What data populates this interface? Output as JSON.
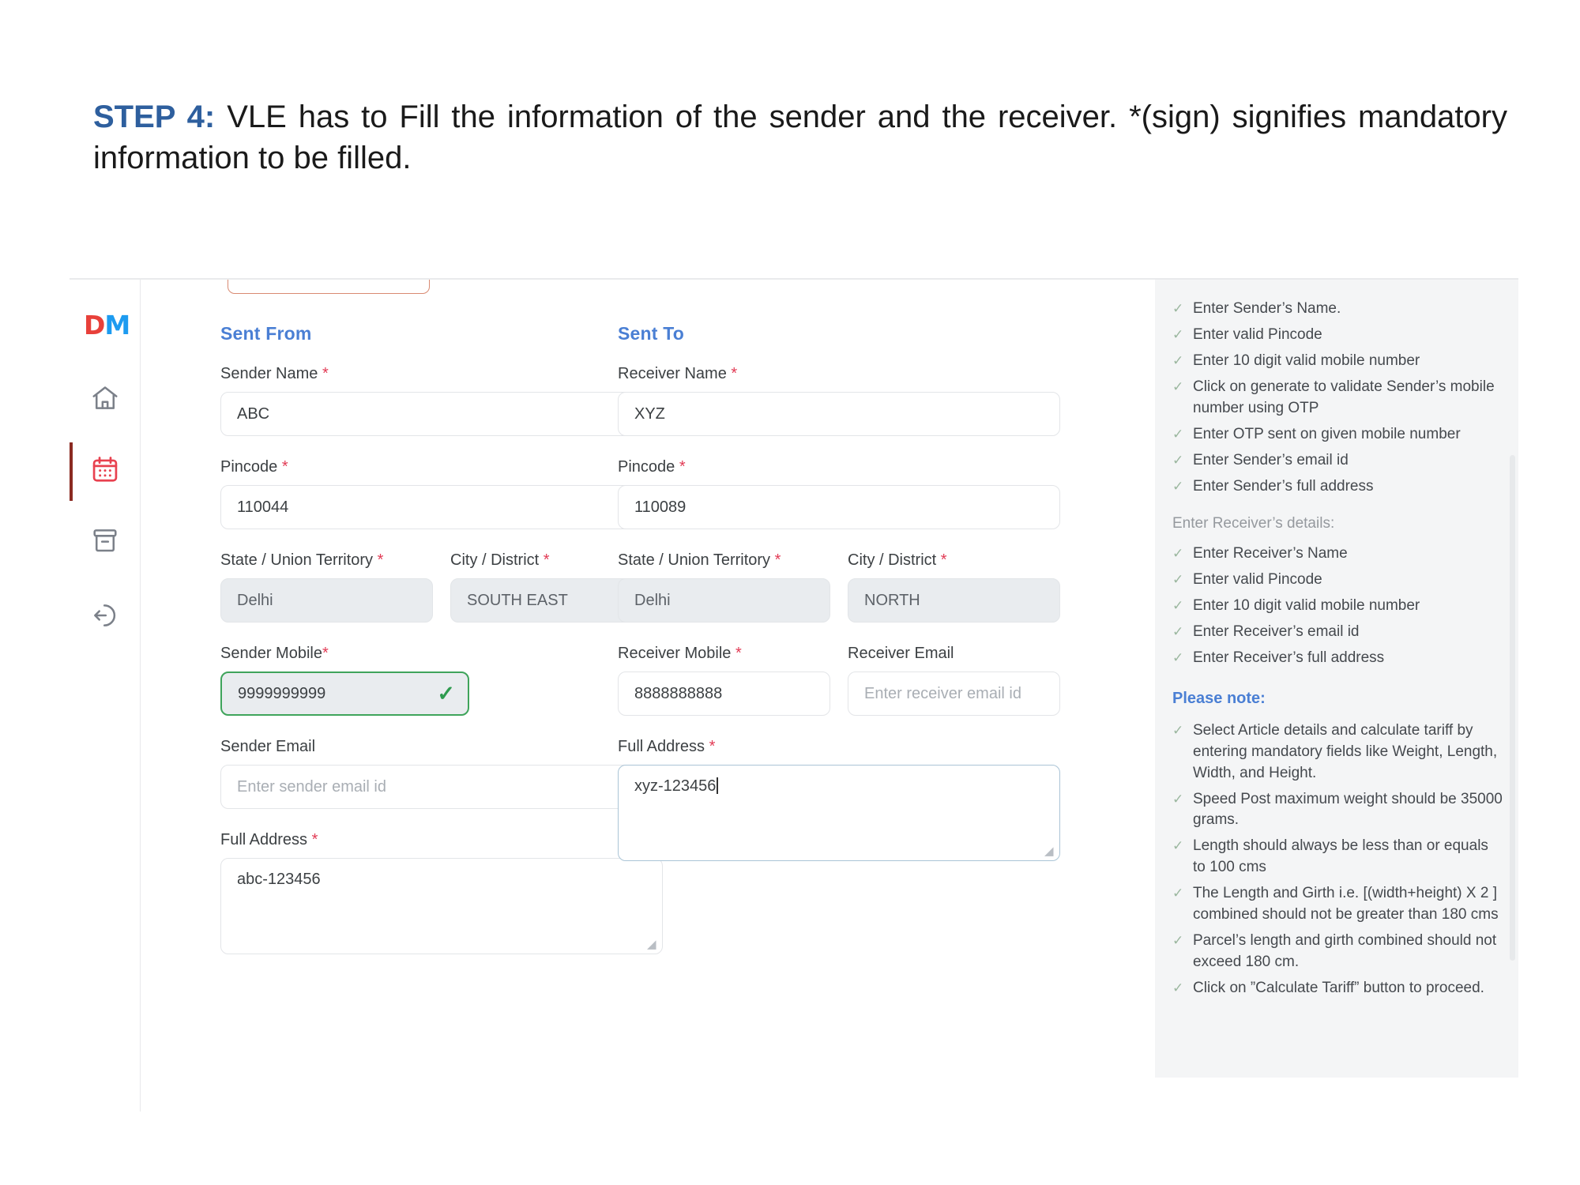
{
  "slide": {
    "step_label": "STEP 4:",
    "body": "VLE has to Fill the information of the sender and the receiver. *(sign) signifies mandatory information to be filled."
  },
  "colors": {
    "accent_blue": "#4a7fd4",
    "required_red": "#e23b55",
    "valid_green": "#3fa45b",
    "logo_red": "#e8403a",
    "logo_blue": "#1d9bf0",
    "active_rail": "#8b2a22"
  },
  "sidebar": {
    "logo_first": "D",
    "logo_second": "M",
    "items": [
      {
        "name": "home-icon",
        "label": "Home",
        "active": false
      },
      {
        "name": "calendar-icon",
        "label": "Booking",
        "active": true
      },
      {
        "name": "archive-icon",
        "label": "Archive",
        "active": false
      },
      {
        "name": "logout-icon",
        "label": "Logout",
        "active": false
      }
    ]
  },
  "sender": {
    "section_title": "Sent From",
    "name_label": "Sender Name",
    "name_value": "ABC",
    "pincode_label": "Pincode",
    "pincode_value": "110044",
    "state_label": "State / Union Territory",
    "state_value": "Delhi",
    "city_label": "City / District",
    "city_value": "SOUTH EAST",
    "mobile_label": "Sender Mobile",
    "mobile_value": "9999999999",
    "mobile_valid_icon": "check-icon",
    "email_label": "Sender Email",
    "email_value": "",
    "email_placeholder": "Enter sender email id",
    "address_label": "Full Address",
    "address_value": "abc-123456"
  },
  "receiver": {
    "section_title": "Sent To",
    "name_label": "Receiver Name",
    "name_value": "XYZ",
    "pincode_label": "Pincode",
    "pincode_value": "110089",
    "state_label": "State / Union Territory",
    "state_value": "Delhi",
    "city_label": "City / District",
    "city_value": "NORTH",
    "mobile_label": "Receiver Mobile",
    "mobile_value": "8888888888",
    "email_label": "Receiver Email",
    "email_value": "",
    "email_placeholder": "Enter receiver email id",
    "address_label": "Full Address",
    "address_value": "xyz-123456"
  },
  "required_marker": "*",
  "help": {
    "sender_items": [
      "Enter Sender’s Name.",
      "Enter valid Pincode",
      "Enter 10 digit valid mobile number",
      "Click on generate to validate Sender’s mobile number using OTP",
      "Enter OTP sent on given mobile number",
      "Enter Sender’s email id",
      "Enter Sender’s full address"
    ],
    "receiver_heading": "Enter Receiver’s details:",
    "receiver_items": [
      "Enter Receiver’s Name",
      "Enter valid Pincode",
      "Enter 10 digit valid mobile number",
      "Enter Receiver’s email id",
      "Enter Receiver’s full address"
    ],
    "note_heading": "Please note:",
    "note_items": [
      "Select Article details and calculate tariff by entering mandatory fields like Weight, Length, Width, and Height.",
      "Speed Post maximum weight should be 35000 grams.",
      "Length should always be less than or equals to 100 cms",
      "The Length and Girth i.e. [(width+height) X 2 ] combined should not be greater than 180 cms",
      "Parcel’s length and girth combined should not exceed 180 cm.",
      "Click on ”Calculate Tariff” button to proceed."
    ],
    "tick_icon": "check-icon"
  }
}
